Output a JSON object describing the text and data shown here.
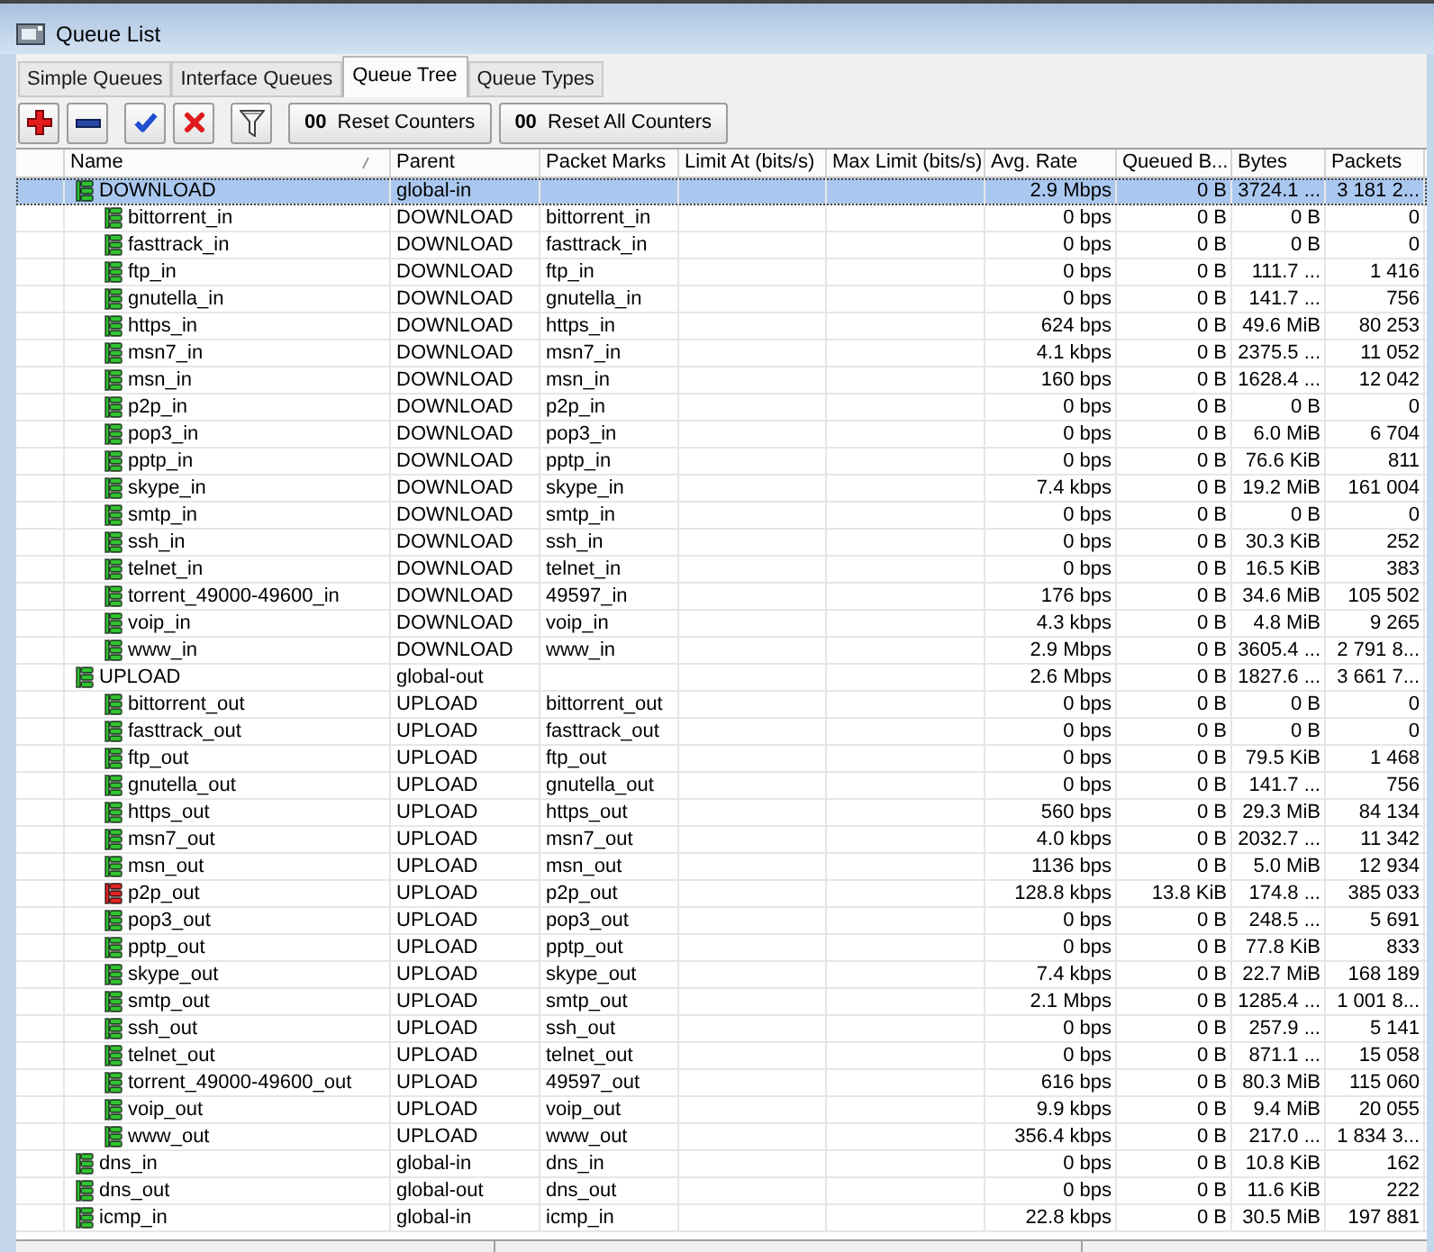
{
  "window": {
    "title": "Queue List"
  },
  "tabs": [
    {
      "label": "Simple Queues",
      "selected": false
    },
    {
      "label": "Interface Queues",
      "selected": false
    },
    {
      "label": "Queue Tree",
      "selected": true
    },
    {
      "label": "Queue Types",
      "selected": false
    }
  ],
  "toolbar": [
    {
      "kind": "add"
    },
    {
      "kind": "remove"
    },
    {
      "kind": "enable"
    },
    {
      "kind": "disable"
    },
    {
      "kind": "filter"
    },
    {
      "kind": "counter",
      "glyph": "00",
      "label": "Reset Counters"
    },
    {
      "kind": "counter",
      "glyph": "00",
      "label": "Reset All Counters"
    }
  ],
  "table": {
    "columns": [
      {
        "label": "Name",
        "sorted": true
      },
      {
        "label": "Parent",
        "sorted": false
      },
      {
        "label": "Packet Marks",
        "sorted": false
      },
      {
        "label": "Limit At (bits/s)",
        "sorted": false
      },
      {
        "label": "Max Limit (bits/s)",
        "sorted": false
      },
      {
        "label": "Avg. Rate",
        "sorted": false
      },
      {
        "label": "Queued B...",
        "sorted": false
      },
      {
        "label": "Bytes",
        "sorted": false
      },
      {
        "label": "Packets",
        "sorted": false
      }
    ],
    "rows": [
      {
        "name": "DOWNLOAD",
        "parent": "global-in",
        "avg_rate": "2.9 Mbps",
        "queued_bytes": "0 B",
        "bytes": "3724.1 ...",
        "packets": "3 181 2...",
        "color": "#33c233",
        "selected": true,
        "children": [
          {
            "name": "bittorrent_in",
            "parent": "DOWNLOAD",
            "packet_marks": "bittorrent_in",
            "avg_rate": "0 bps",
            "queued_bytes": "0 B",
            "bytes": "0 B",
            "packets": "0",
            "color": "#33c233",
            "selected": false
          },
          {
            "name": "fasttrack_in",
            "parent": "DOWNLOAD",
            "packet_marks": "fasttrack_in",
            "avg_rate": "0 bps",
            "queued_bytes": "0 B",
            "bytes": "0 B",
            "packets": "0",
            "color": "#33c233",
            "selected": false
          },
          {
            "name": "ftp_in",
            "parent": "DOWNLOAD",
            "packet_marks": "ftp_in",
            "avg_rate": "0 bps",
            "queued_bytes": "0 B",
            "bytes": "111.7 ...",
            "packets": "1 416",
            "color": "#33c233",
            "selected": false
          },
          {
            "name": "gnutella_in",
            "parent": "DOWNLOAD",
            "packet_marks": "gnutella_in",
            "avg_rate": "0 bps",
            "queued_bytes": "0 B",
            "bytes": "141.7 ...",
            "packets": "756",
            "color": "#33c233",
            "selected": false
          },
          {
            "name": "https_in",
            "parent": "DOWNLOAD",
            "packet_marks": "https_in",
            "avg_rate": "624 bps",
            "queued_bytes": "0 B",
            "bytes": "49.6 MiB",
            "packets": "80 253",
            "color": "#33c233",
            "selected": false
          },
          {
            "name": "msn7_in",
            "parent": "DOWNLOAD",
            "packet_marks": "msn7_in",
            "avg_rate": "4.1 kbps",
            "queued_bytes": "0 B",
            "bytes": "2375.5 ...",
            "packets": "11 052",
            "color": "#33c233",
            "selected": false
          },
          {
            "name": "msn_in",
            "parent": "DOWNLOAD",
            "packet_marks": "msn_in",
            "avg_rate": "160 bps",
            "queued_bytes": "0 B",
            "bytes": "1628.4 ...",
            "packets": "12 042",
            "color": "#33c233",
            "selected": false
          },
          {
            "name": "p2p_in",
            "parent": "DOWNLOAD",
            "packet_marks": "p2p_in",
            "avg_rate": "0 bps",
            "queued_bytes": "0 B",
            "bytes": "0 B",
            "packets": "0",
            "color": "#33c233",
            "selected": false
          },
          {
            "name": "pop3_in",
            "parent": "DOWNLOAD",
            "packet_marks": "pop3_in",
            "avg_rate": "0 bps",
            "queued_bytes": "0 B",
            "bytes": "6.0 MiB",
            "packets": "6 704",
            "color": "#33c233",
            "selected": false
          },
          {
            "name": "pptp_in",
            "parent": "DOWNLOAD",
            "packet_marks": "pptp_in",
            "avg_rate": "0 bps",
            "queued_bytes": "0 B",
            "bytes": "76.6 KiB",
            "packets": "811",
            "color": "#33c233",
            "selected": false
          },
          {
            "name": "skype_in",
            "parent": "DOWNLOAD",
            "packet_marks": "skype_in",
            "avg_rate": "7.4 kbps",
            "queued_bytes": "0 B",
            "bytes": "19.2 MiB",
            "packets": "161 004",
            "color": "#33c233",
            "selected": false
          },
          {
            "name": "smtp_in",
            "parent": "DOWNLOAD",
            "packet_marks": "smtp_in",
            "avg_rate": "0 bps",
            "queued_bytes": "0 B",
            "bytes": "0 B",
            "packets": "0",
            "color": "#33c233",
            "selected": false
          },
          {
            "name": "ssh_in",
            "parent": "DOWNLOAD",
            "packet_marks": "ssh_in",
            "avg_rate": "0 bps",
            "queued_bytes": "0 B",
            "bytes": "30.3 KiB",
            "packets": "252",
            "color": "#33c233",
            "selected": false
          },
          {
            "name": "telnet_in",
            "parent": "DOWNLOAD",
            "packet_marks": "telnet_in",
            "avg_rate": "0 bps",
            "queued_bytes": "0 B",
            "bytes": "16.5 KiB",
            "packets": "383",
            "color": "#33c233",
            "selected": false
          },
          {
            "name": "torrent_49000-49600_in",
            "parent": "DOWNLOAD",
            "packet_marks": "49597_in",
            "avg_rate": "176 bps",
            "queued_bytes": "0 B",
            "bytes": "34.6 MiB",
            "packets": "105 502",
            "color": "#33c233",
            "selected": false
          },
          {
            "name": "voip_in",
            "parent": "DOWNLOAD",
            "packet_marks": "voip_in",
            "avg_rate": "4.3 kbps",
            "queued_bytes": "0 B",
            "bytes": "4.8 MiB",
            "packets": "9 265",
            "color": "#33c233",
            "selected": false
          },
          {
            "name": "www_in",
            "parent": "DOWNLOAD",
            "packet_marks": "www_in",
            "avg_rate": "2.9 Mbps",
            "queued_bytes": "0 B",
            "bytes": "3605.4 ...",
            "packets": "2 791 8...",
            "color": "#33c233",
            "selected": false
          }
        ]
      },
      {
        "name": "UPLOAD",
        "parent": "global-out",
        "avg_rate": "2.6 Mbps",
        "queued_bytes": "0 B",
        "bytes": "1827.6 ...",
        "packets": "3 661 7...",
        "color": "#33c233",
        "selected": false,
        "children": [
          {
            "name": "bittorrent_out",
            "parent": "UPLOAD",
            "packet_marks": "bittorrent_out",
            "avg_rate": "0 bps",
            "queued_bytes": "0 B",
            "bytes": "0 B",
            "packets": "0",
            "color": "#33c233",
            "selected": false
          },
          {
            "name": "fasttrack_out",
            "parent": "UPLOAD",
            "packet_marks": "fasttrack_out",
            "avg_rate": "0 bps",
            "queued_bytes": "0 B",
            "bytes": "0 B",
            "packets": "0",
            "color": "#33c233",
            "selected": false
          },
          {
            "name": "ftp_out",
            "parent": "UPLOAD",
            "packet_marks": "ftp_out",
            "avg_rate": "0 bps",
            "queued_bytes": "0 B",
            "bytes": "79.5 KiB",
            "packets": "1 468",
            "color": "#33c233",
            "selected": false
          },
          {
            "name": "gnutella_out",
            "parent": "UPLOAD",
            "packet_marks": "gnutella_out",
            "avg_rate": "0 bps",
            "queued_bytes": "0 B",
            "bytes": "141.7 ...",
            "packets": "756",
            "color": "#33c233",
            "selected": false
          },
          {
            "name": "https_out",
            "parent": "UPLOAD",
            "packet_marks": "https_out",
            "avg_rate": "560 bps",
            "queued_bytes": "0 B",
            "bytes": "29.3 MiB",
            "packets": "84 134",
            "color": "#33c233",
            "selected": false
          },
          {
            "name": "msn7_out",
            "parent": "UPLOAD",
            "packet_marks": "msn7_out",
            "avg_rate": "4.0 kbps",
            "queued_bytes": "0 B",
            "bytes": "2032.7 ...",
            "packets": "11 342",
            "color": "#33c233",
            "selected": false
          },
          {
            "name": "msn_out",
            "parent": "UPLOAD",
            "packet_marks": "msn_out",
            "avg_rate": "1136 bps",
            "queued_bytes": "0 B",
            "bytes": "5.0 MiB",
            "packets": "12 934",
            "color": "#33c233",
            "selected": false
          },
          {
            "name": "p2p_out",
            "parent": "UPLOAD",
            "packet_marks": "p2p_out",
            "avg_rate": "128.8 kbps",
            "queued_bytes": "13.8 KiB",
            "bytes": "174.8 ...",
            "packets": "385 033",
            "color": "#e02424",
            "selected": false
          },
          {
            "name": "pop3_out",
            "parent": "UPLOAD",
            "packet_marks": "pop3_out",
            "avg_rate": "0 bps",
            "queued_bytes": "0 B",
            "bytes": "248.5 ...",
            "packets": "5 691",
            "color": "#33c233",
            "selected": false
          },
          {
            "name": "pptp_out",
            "parent": "UPLOAD",
            "packet_marks": "pptp_out",
            "avg_rate": "0 bps",
            "queued_bytes": "0 B",
            "bytes": "77.8 KiB",
            "packets": "833",
            "color": "#33c233",
            "selected": false
          },
          {
            "name": "skype_out",
            "parent": "UPLOAD",
            "packet_marks": "skype_out",
            "avg_rate": "7.4 kbps",
            "queued_bytes": "0 B",
            "bytes": "22.7 MiB",
            "packets": "168 189",
            "color": "#33c233",
            "selected": false
          },
          {
            "name": "smtp_out",
            "parent": "UPLOAD",
            "packet_marks": "smtp_out",
            "avg_rate": "2.1 Mbps",
            "queued_bytes": "0 B",
            "bytes": "1285.4 ...",
            "packets": "1 001 8...",
            "color": "#33c233",
            "selected": false
          },
          {
            "name": "ssh_out",
            "parent": "UPLOAD",
            "packet_marks": "ssh_out",
            "avg_rate": "0 bps",
            "queued_bytes": "0 B",
            "bytes": "257.9 ...",
            "packets": "5 141",
            "color": "#33c233",
            "selected": false
          },
          {
            "name": "telnet_out",
            "parent": "UPLOAD",
            "packet_marks": "telnet_out",
            "avg_rate": "0 bps",
            "queued_bytes": "0 B",
            "bytes": "871.1 ...",
            "packets": "15 058",
            "color": "#33c233",
            "selected": false
          },
          {
            "name": "torrent_49000-49600_out",
            "parent": "UPLOAD",
            "packet_marks": "49597_out",
            "avg_rate": "616 bps",
            "queued_bytes": "0 B",
            "bytes": "80.3 MiB",
            "packets": "115 060",
            "color": "#33c233",
            "selected": false
          },
          {
            "name": "voip_out",
            "parent": "UPLOAD",
            "packet_marks": "voip_out",
            "avg_rate": "9.9 kbps",
            "queued_bytes": "0 B",
            "bytes": "9.4 MiB",
            "packets": "20 055",
            "color": "#33c233",
            "selected": false
          },
          {
            "name": "www_out",
            "parent": "UPLOAD",
            "packet_marks": "www_out",
            "avg_rate": "356.4 kbps",
            "queued_bytes": "0 B",
            "bytes": "217.0 ...",
            "packets": "1 834 3...",
            "color": "#33c233",
            "selected": false
          }
        ]
      },
      {
        "name": "dns_in",
        "parent": "global-in",
        "packet_marks": "dns_in",
        "avg_rate": "0 bps",
        "queued_bytes": "0 B",
        "bytes": "10.8 KiB",
        "packets": "162",
        "color": "#33c233",
        "selected": false
      },
      {
        "name": "dns_out",
        "parent": "global-out",
        "packet_marks": "dns_out",
        "avg_rate": "0 bps",
        "queued_bytes": "0 B",
        "bytes": "11.6 KiB",
        "packets": "222",
        "color": "#33c233",
        "selected": false
      },
      {
        "name": "icmp_in",
        "parent": "global-in",
        "packet_marks": "icmp_in",
        "avg_rate": "22.8 kbps",
        "queued_bytes": "0 B",
        "bytes": "30.5 MiB",
        "packets": "197 881",
        "color": "#33c233",
        "selected": false
      }
    ]
  }
}
